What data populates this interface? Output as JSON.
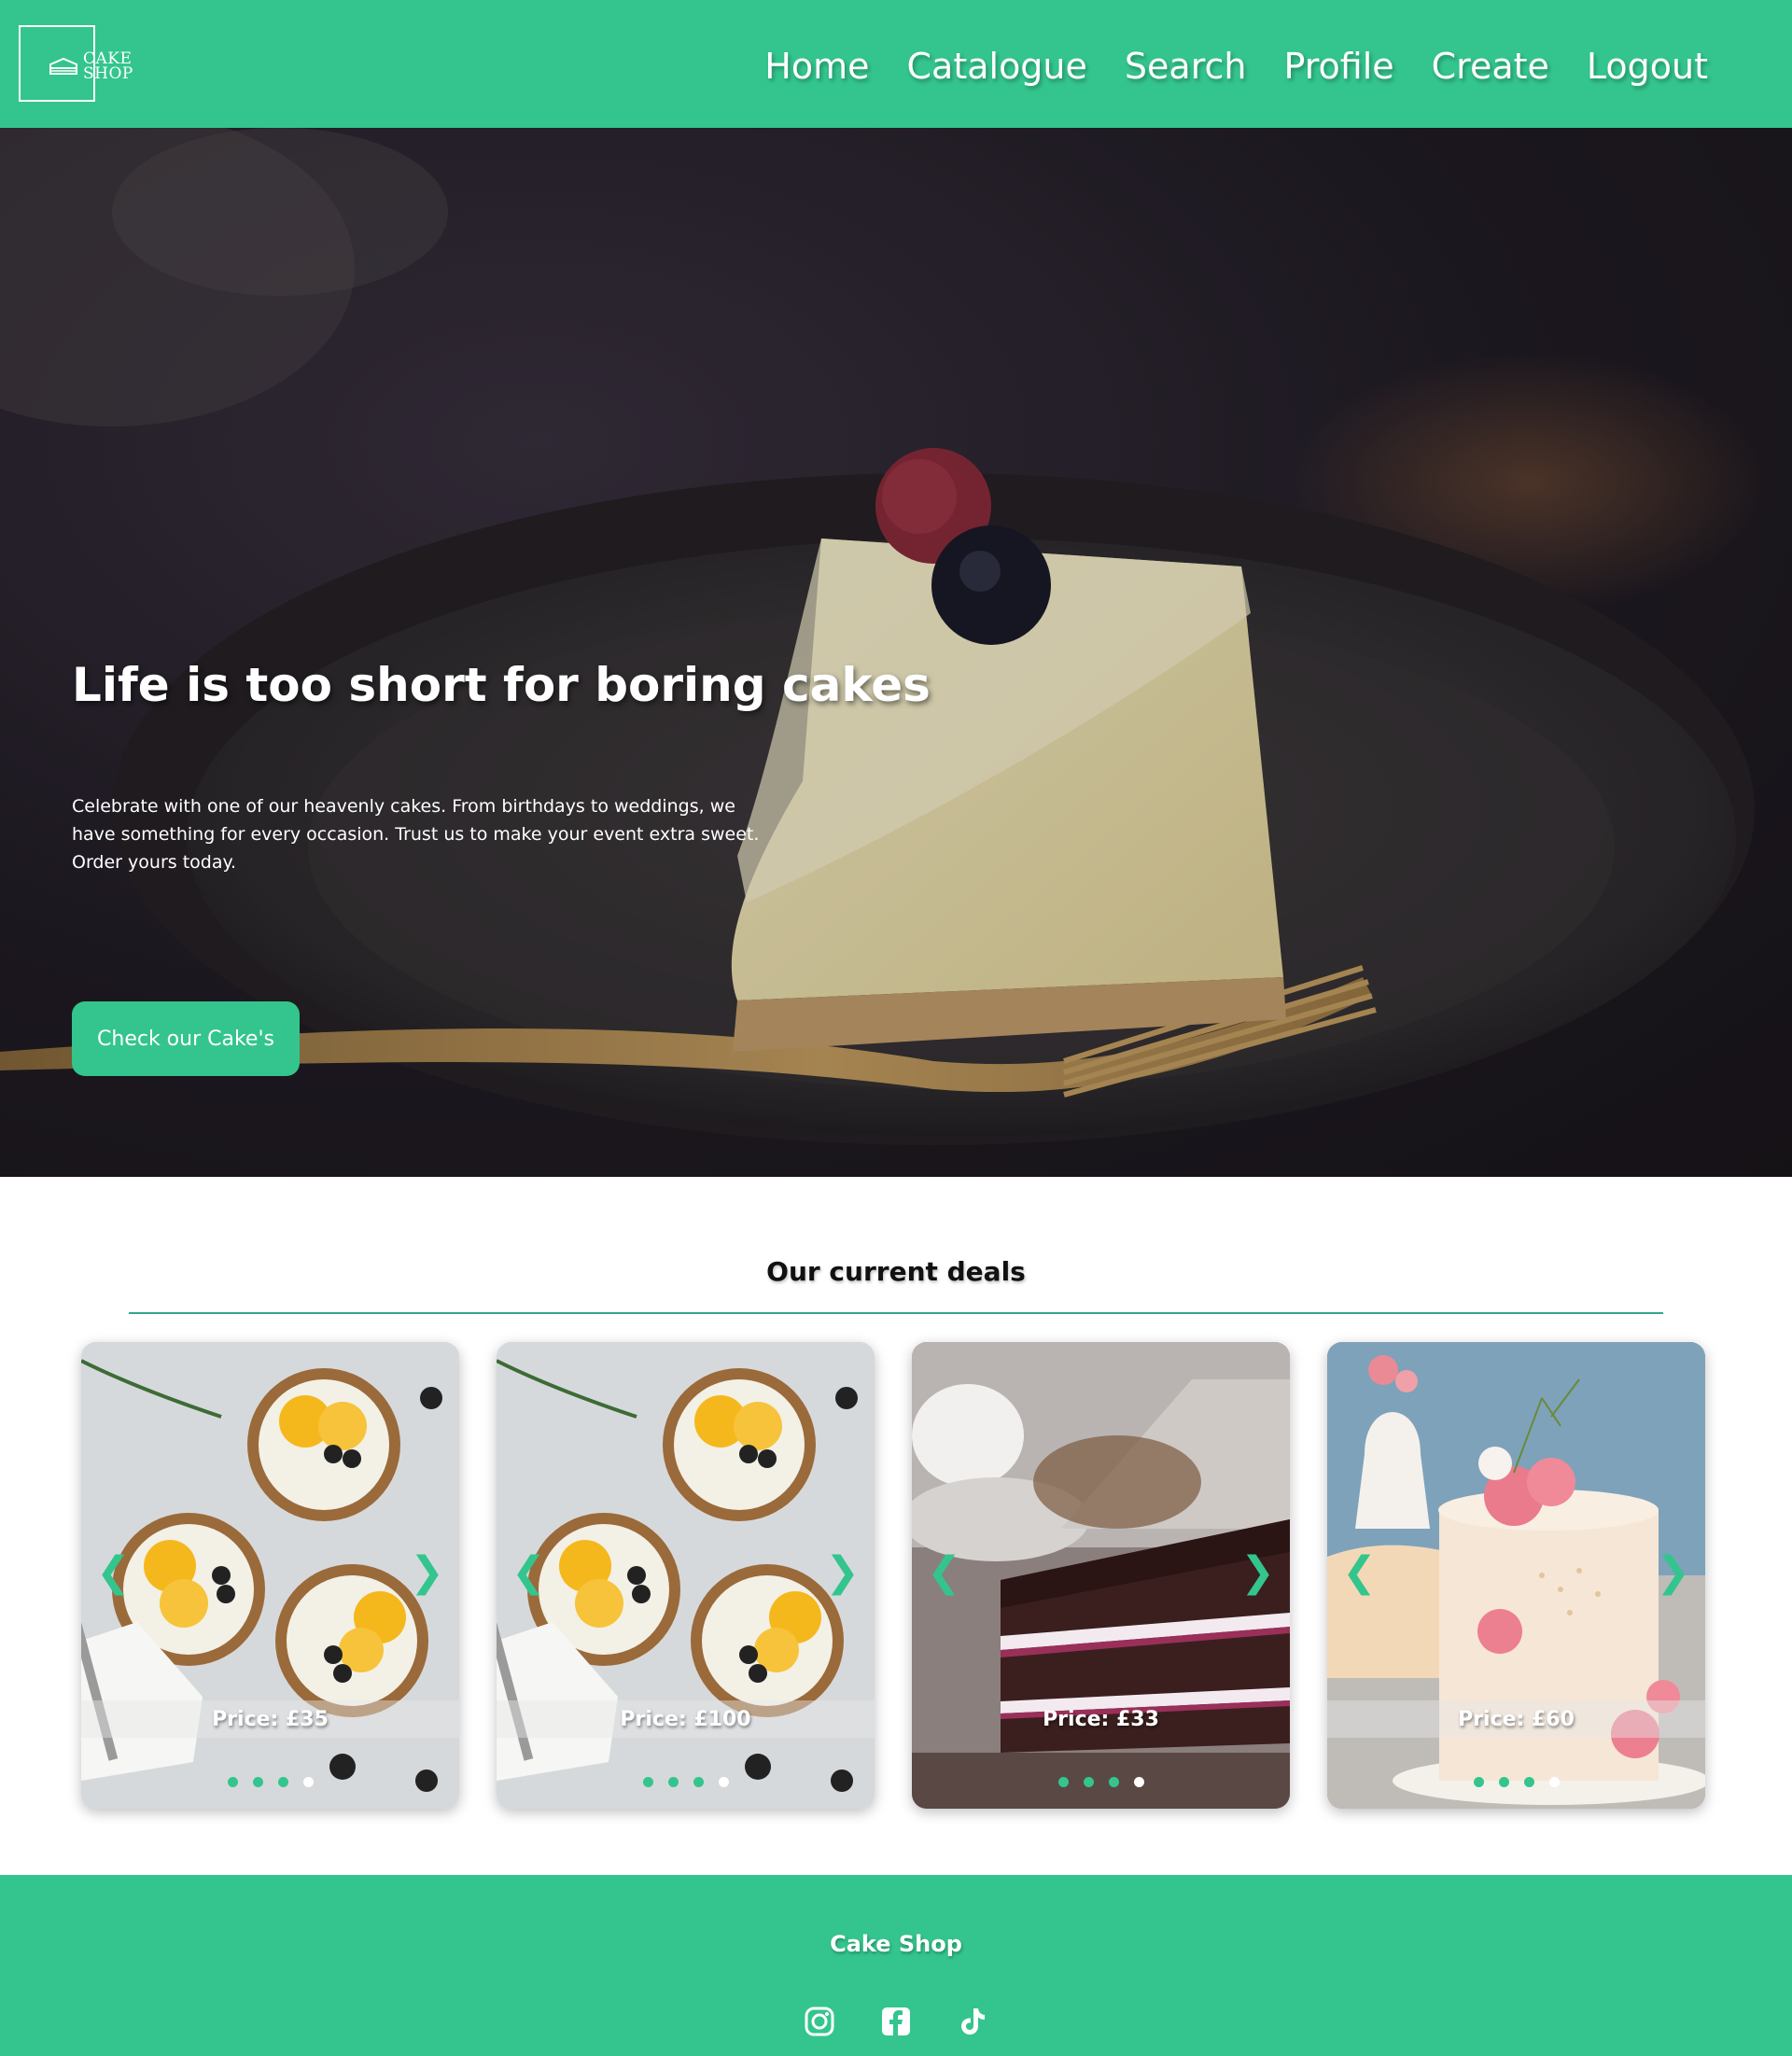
{
  "brand": {
    "logo_line1": "CAKE",
    "logo_line2": "SHOP",
    "accent_color": "#33c58d"
  },
  "nav": {
    "items": [
      {
        "label": "Home"
      },
      {
        "label": "Catalogue"
      },
      {
        "label": "Search"
      },
      {
        "label": "Profile"
      },
      {
        "label": "Create"
      },
      {
        "label": "Logout"
      }
    ]
  },
  "hero": {
    "title": "Life is too short for boring cakes",
    "text": "Celebrate with one of our heavenly cakes. From birthdays to weddings, we have something for every occasion. Trust us to make your event extra sweet. Order yours today.",
    "button_label": "Check our Cake's"
  },
  "deals": {
    "title": "Our current deals",
    "cards": [
      {
        "price": "Price: £35",
        "image": "fruit-tarts",
        "dots": 4,
        "active_dot": 4
      },
      {
        "price": "Price: £100",
        "image": "fruit-tarts",
        "dots": 4,
        "active_dot": 4
      },
      {
        "price": "Price: £33",
        "image": "chocolate-cake-slice",
        "dots": 4,
        "active_dot": 4
      },
      {
        "price": "Price: £60",
        "image": "floral-cake",
        "dots": 4,
        "active_dot": 4
      }
    ],
    "prev_icon": "chevron-left-icon",
    "next_icon": "chevron-right-icon"
  },
  "footer": {
    "title": "Cake Shop",
    "socials": [
      {
        "icon": "instagram-icon"
      },
      {
        "icon": "facebook-icon"
      },
      {
        "icon": "tiktok-icon"
      }
    ]
  }
}
